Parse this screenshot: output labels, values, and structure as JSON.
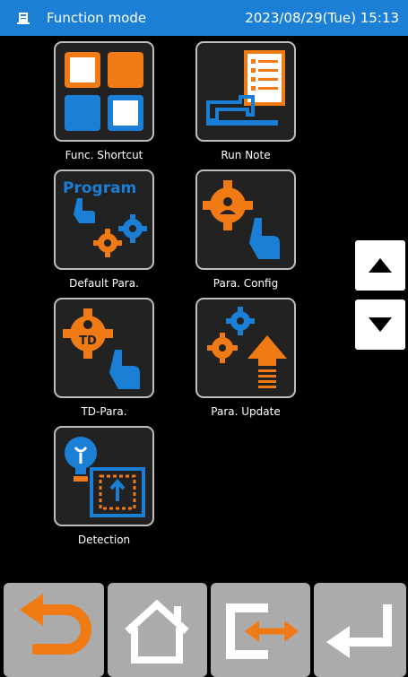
{
  "header": {
    "title": "Function mode",
    "datetime": "2023/08/29(Tue) 15:13",
    "icon": "device-icon"
  },
  "tiles": [
    {
      "id": "func-shortcut",
      "label": "Func. Shortcut",
      "icon": "grid-shortcut-icon"
    },
    {
      "id": "run-note",
      "label": "Run Note",
      "icon": "sewing-machine-note-icon"
    },
    {
      "id": "default-para",
      "label": "Default Para.",
      "icon": "program-gear-hand-icon",
      "icon_text": "Program"
    },
    {
      "id": "para-config",
      "label": "Para. Config",
      "icon": "gear-person-hand-icon"
    },
    {
      "id": "td-para",
      "label": "TD-Para.",
      "icon": "td-gear-hand-icon",
      "icon_text": "TD"
    },
    {
      "id": "para-update",
      "label": "Para. Update",
      "icon": "gears-arrow-up-icon"
    },
    {
      "id": "detection",
      "label": "Detection",
      "icon": "bulb-detection-icon"
    }
  ],
  "side_buttons": {
    "up": {
      "icon": "triangle-up-icon"
    },
    "down": {
      "icon": "triangle-down-icon"
    }
  },
  "nav_buttons": [
    {
      "id": "back",
      "icon": "return-arrow-icon"
    },
    {
      "id": "home",
      "icon": "home-icon"
    },
    {
      "id": "switch",
      "icon": "switch-exchange-icon"
    },
    {
      "id": "enter",
      "icon": "enter-arrow-icon"
    }
  ],
  "colors": {
    "accent_blue": "#1b7fd6",
    "accent_orange": "#f07a14",
    "tile_bg": "#222222",
    "nav_bg": "#ababab"
  }
}
